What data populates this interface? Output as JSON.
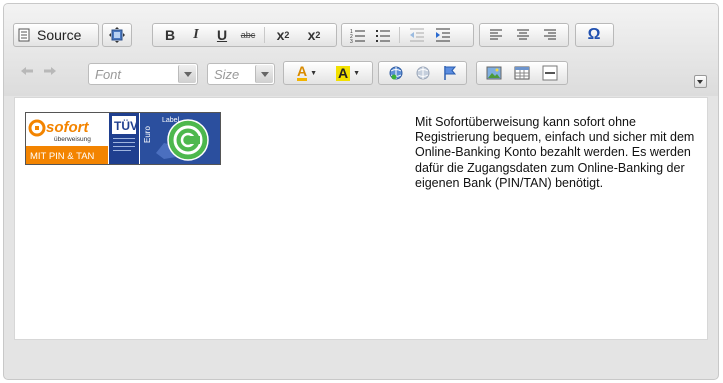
{
  "toolbar": {
    "source_label": "Source",
    "bold_label": "B",
    "italic_label": "I",
    "underline_label": "U",
    "strike_label": "abc",
    "subscript_label": "x",
    "subscript_sub": "2",
    "superscript_label": "x",
    "superscript_sup": "2",
    "special_char_label": "Ω",
    "font_placeholder": "Font",
    "size_placeholder": "Size",
    "text_color_label": "A",
    "bg_color_label": "A"
  },
  "logo": {
    "sofort_label": "sofort",
    "ueberweisung_label": "überweisung",
    "pin_tan_label": "MIT PIN & TAN",
    "tuv_label": "TÜV",
    "euro_label": "Euro",
    "label_text": "Label"
  },
  "content": {
    "paragraph": "Mit Sofortüberweisung kann sofort ohne Registrierung bequem, einfach und sicher mit dem Online-Banking Konto bezahlt werden. Es werden dafür die Zugangsdaten zum Online-Banking der eigenen Bank (PIN/TAN) benötigt."
  },
  "colors": {
    "sofort_orange": "#f38400",
    "tuv_blue": "#1f3f8f",
    "link_blue": "#2a5db0",
    "special_char_blue": "#2050b0"
  }
}
